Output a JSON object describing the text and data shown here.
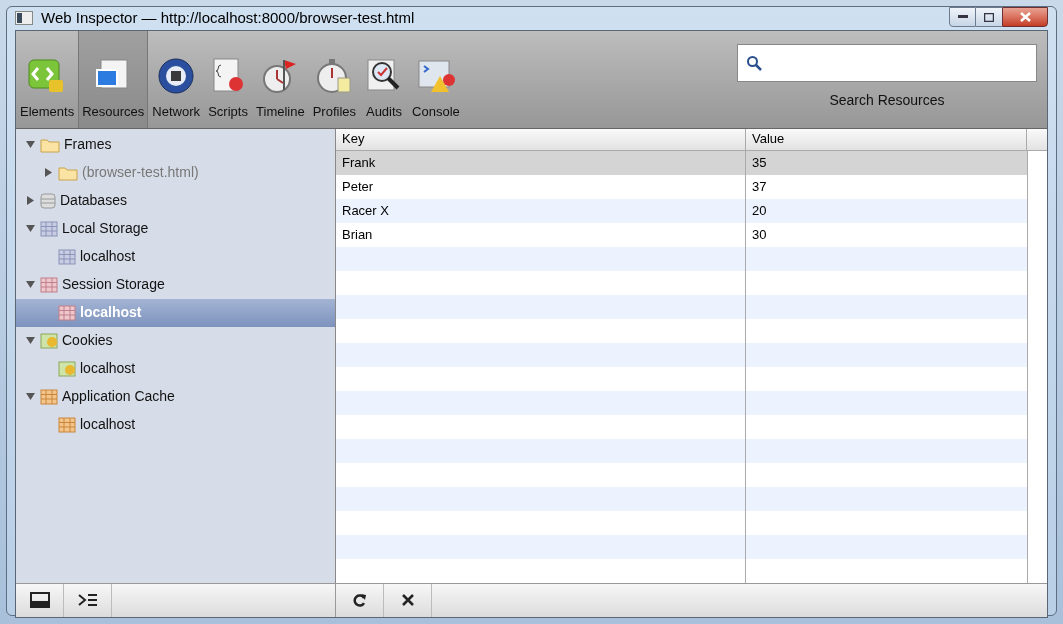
{
  "window": {
    "title": "Web Inspector — http://localhost:8000/browser-test.html"
  },
  "toolbar": {
    "tabs": [
      {
        "kind": "elements",
        "label": "Elements",
        "selected": false
      },
      {
        "kind": "resources",
        "label": "Resources",
        "selected": true
      },
      {
        "kind": "network",
        "label": "Network",
        "selected": false
      },
      {
        "kind": "scripts",
        "label": "Scripts",
        "selected": false
      },
      {
        "kind": "timeline",
        "label": "Timeline",
        "selected": false
      },
      {
        "kind": "profiles",
        "label": "Profiles",
        "selected": false
      },
      {
        "kind": "audits",
        "label": "Audits",
        "selected": false
      },
      {
        "kind": "console",
        "label": "Console",
        "selected": false
      }
    ],
    "search": {
      "label": "Search Resources"
    }
  },
  "sidebar": {
    "items": [
      {
        "kind": "folder",
        "label": "Frames",
        "expanded": true,
        "selected": false,
        "children": [
          {
            "kind": "folder",
            "label": "(browser-test.html)",
            "expanded": false,
            "selected": false,
            "dim": true
          }
        ]
      },
      {
        "kind": "database",
        "label": "Databases",
        "expanded": false,
        "selected": false
      },
      {
        "kind": "local",
        "label": "Local Storage",
        "expanded": true,
        "selected": false,
        "children": [
          {
            "kind": "local",
            "label": "localhost",
            "selected": false
          }
        ]
      },
      {
        "kind": "session",
        "label": "Session Storage",
        "expanded": true,
        "selected": false,
        "children": [
          {
            "kind": "session",
            "label": "localhost",
            "selected": true
          }
        ]
      },
      {
        "kind": "cookie",
        "label": "Cookies",
        "expanded": true,
        "selected": false,
        "children": [
          {
            "kind": "cookie",
            "label": "localhost",
            "selected": false
          }
        ]
      },
      {
        "kind": "appcache",
        "label": "Application Cache",
        "expanded": true,
        "selected": false,
        "children": [
          {
            "kind": "appcache",
            "label": "localhost",
            "selected": false
          }
        ]
      }
    ]
  },
  "table": {
    "columns": [
      "Key",
      "Value"
    ],
    "rows": [
      {
        "cells": [
          "Frank",
          "35"
        ],
        "selected": true
      },
      {
        "cells": [
          "Peter",
          "37"
        ],
        "selected": false
      },
      {
        "cells": [
          "Racer X",
          "20"
        ],
        "selected": false
      },
      {
        "cells": [
          "Brian",
          "30"
        ],
        "selected": false
      }
    ]
  }
}
